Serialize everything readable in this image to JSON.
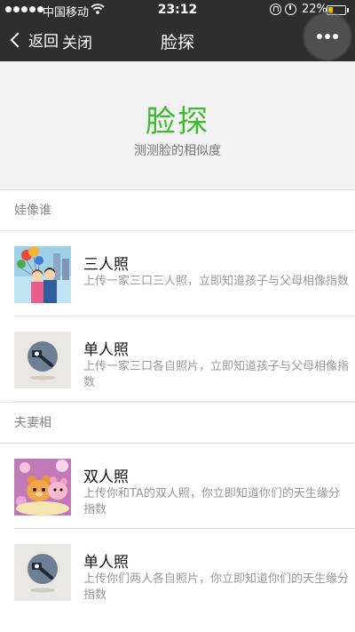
{
  "status_bar": {
    "carrier": "中国移动",
    "time": "23:12",
    "battery": "22%",
    "battery_level": 0.22
  },
  "nav": {
    "back_label": "返回",
    "close_label": "关闭",
    "title": "脸探"
  },
  "hero": {
    "title": "脸探",
    "subtitle": "测测脸的相似度"
  },
  "sections": [
    {
      "header": "娃像谁",
      "items": [
        {
          "title": "三人照",
          "desc": "上传一家三口三人照，立即知道孩子与父母相像指数",
          "icon": "family-photo-icon"
        },
        {
          "title": "单人照",
          "desc": "上传一家三口各自照片，立即知道孩子与父母相像指数",
          "icon": "camera-placeholder-icon"
        }
      ]
    },
    {
      "header": "夫妻相",
      "items": [
        {
          "title": "双人照",
          "desc": "上传你和TA的双人照，你立即知道你们的天生缘分指数",
          "icon": "couple-bears-icon"
        },
        {
          "title": "单人照",
          "desc": "上传你们两人各自照片，你立即知道你们的天生缘分指数",
          "icon": "camera-placeholder-icon"
        }
      ]
    }
  ],
  "colors": {
    "accent_green": "#3dbb2f",
    "nav_bg": "#2e2e2e"
  }
}
